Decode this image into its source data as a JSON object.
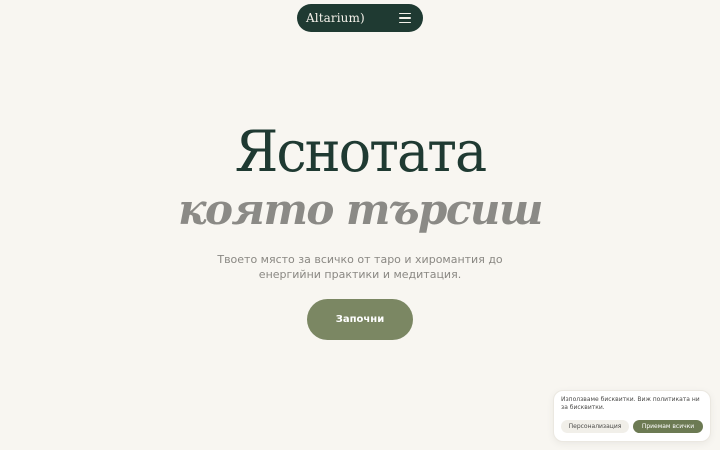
{
  "header": {
    "logo": "Altarium)",
    "menu_icon": "hamburger-menu-icon"
  },
  "hero": {
    "title": "Яснотата",
    "subtitle": "която търсиш",
    "description": "Твоето място за всичко от таро и хиромантия до енергийни практики и медитация.",
    "cta_label": "Започни"
  },
  "cookie_banner": {
    "text": "Използваме бисквитки. Виж политиката ни за бисквитки.",
    "customize_label": "Персонализация",
    "accept_label": "Приемам всички"
  },
  "colors": {
    "background": "#f8f6f1",
    "primary_dark": "#1f3a32",
    "accent_green": "#7b8763",
    "muted_text": "#8a8883"
  }
}
